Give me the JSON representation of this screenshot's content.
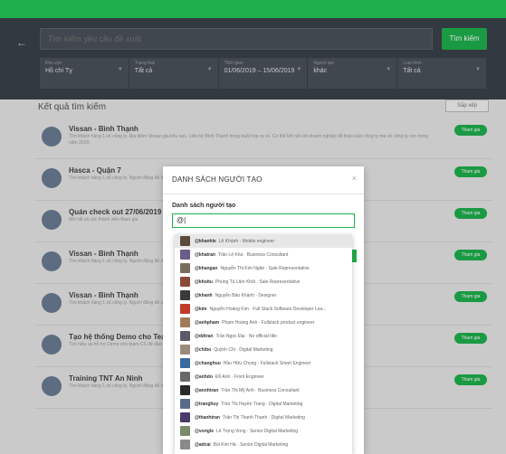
{
  "search": {
    "placeholder": "Tìm kiếm yêu cầu đề xuất",
    "button_label": "Tìm kiếm"
  },
  "filters": [
    {
      "label": "Khu vực",
      "value": "Hồ chí Tỵ"
    },
    {
      "label": "Trạng thái",
      "value": "Tất cả"
    },
    {
      "label": "Thời gian",
      "value": "01/06/2019 – 15/06/2019"
    },
    {
      "label": "Người tạo",
      "value": "khác"
    },
    {
      "label": "Loại hình",
      "value": "Tất cả"
    }
  ],
  "results": {
    "title": "Kết quả tìm kiếm",
    "sort_label": "Sắp xếp",
    "cards": [
      {
        "title": "Vissan - Bình Thạnh",
        "desc": "Tìm khách hàng 1 số công ty. Địa điểm Vissan gia khu vực. Liên hệ Bình Thạnh trong buổi họp ra cố. Có thể kết nối với doanh nghiệp để thảo luận công ty mẹ về công ty con trong năm 2019.",
        "join": "Tham gia"
      },
      {
        "title": "Hasca - Quận 7",
        "desc": "Tìm khách hàng 1 số công ty. Người đăng đề xuất khu vực quận 7. Có thể liên kết với đối tác cho dự án mới.",
        "join": "Tham gia"
      },
      {
        "title": "Quán check out 27/06/2019",
        "desc": "Mời tất cả các thành viên tham gia",
        "join": "Tham gia"
      },
      {
        "title": "Vissan - Bình Thạnh",
        "desc": "Tìm khách hàng 1 số công ty. Người đăng đề xuất gia khu vực Bình Thạnh. Các đối tác liên quan đến dự án.",
        "join": "Tham gia"
      },
      {
        "title": "Vissan - Bình Thạnh",
        "desc": "Tìm khách hàng 1 số công ty. Người đăng đề xuất gia khu vực Bình Thạnh. Có thể phối hợp với đối tác cho dự án.",
        "join": "Tham gia"
      },
      {
        "title": "Tạo hệ thống Demo cho Team CS",
        "desc": "Tìm hiểu và hỗ trợ Demo cho team CS để đào tạo khách hàng.",
        "join": "Tham gia"
      },
      {
        "title": "Training TNT An Ninh",
        "desc": "Tìm khách hàng 1 số công ty. Người đăng đề xuất đào tạo an ninh.",
        "join": "Tham gia"
      }
    ]
  },
  "modal": {
    "title": "DANH SÁCH NGƯỜI TẠO",
    "label": "Danh sách người tạo",
    "input_value": "@|"
  },
  "dropdown": [
    {
      "handle": "@khanhle",
      "desc": "Lê Khánh · Mobile engineer",
      "color": "#5a4a3a"
    },
    {
      "handle": "@khatran",
      "desc": "Trần Lệ Kha · Business Consultant",
      "color": "#6b5d8a"
    },
    {
      "handle": "@khangan",
      "desc": "Nguyễn Thị Kim Ngân · Sale Representative",
      "color": "#7a6d60"
    },
    {
      "handle": "@khoitu",
      "desc": "Phùng Tú Lâm Khôi · Sale Representative",
      "color": "#8a4a3a"
    },
    {
      "handle": "@khanh",
      "desc": "Nguyễn Bảo Khánh · Designer",
      "color": "#3a3a3a"
    },
    {
      "handle": "@kim",
      "desc": "Nguyễn Hoàng Kim · Full Stack Software Developer Lea...",
      "color": "#c23a2a"
    },
    {
      "handle": "@anhpham",
      "desc": "Phạm Hoàng Anh · Fullstack product engineer",
      "color": "#a07a5a"
    },
    {
      "handle": "@ddtran",
      "desc": "Trần Ngọc Đại · No official title",
      "color": "#5a5a6a"
    },
    {
      "handle": "@chibo",
      "desc": "Quỳnh Chi · Digital Marketing",
      "color": "#9a8a7a"
    },
    {
      "handle": "@changhuu",
      "desc": "Hầu Hữu Chung · Fullstack Smart Engineer",
      "color": "#3a6aa0"
    },
    {
      "handle": "@anhdo",
      "desc": "Đỗ Anh · Front Engineer",
      "color": "#6a6a6a"
    },
    {
      "handle": "@annhtran",
      "desc": "Trần Thị Mỹ Anh · Business Consultant",
      "color": "#2a2a2a"
    },
    {
      "handle": "@tranghuy",
      "desc": "Trần Thị Huyền Trang · Digital Marketing",
      "color": "#5a6a8a"
    },
    {
      "handle": "@thanhtran",
      "desc": "Trần Thị Thanh Thanh · Digital Marketing",
      "color": "#4a3a6a"
    },
    {
      "handle": "@vongle",
      "desc": "Lê Trọng Vong · Senior Digital Marketing",
      "color": "#7a8a6a"
    },
    {
      "handle": "@adcai",
      "desc": "Bùi Kim Hà · Senior Digital Marketing",
      "color": "#8a8a8a"
    }
  ]
}
